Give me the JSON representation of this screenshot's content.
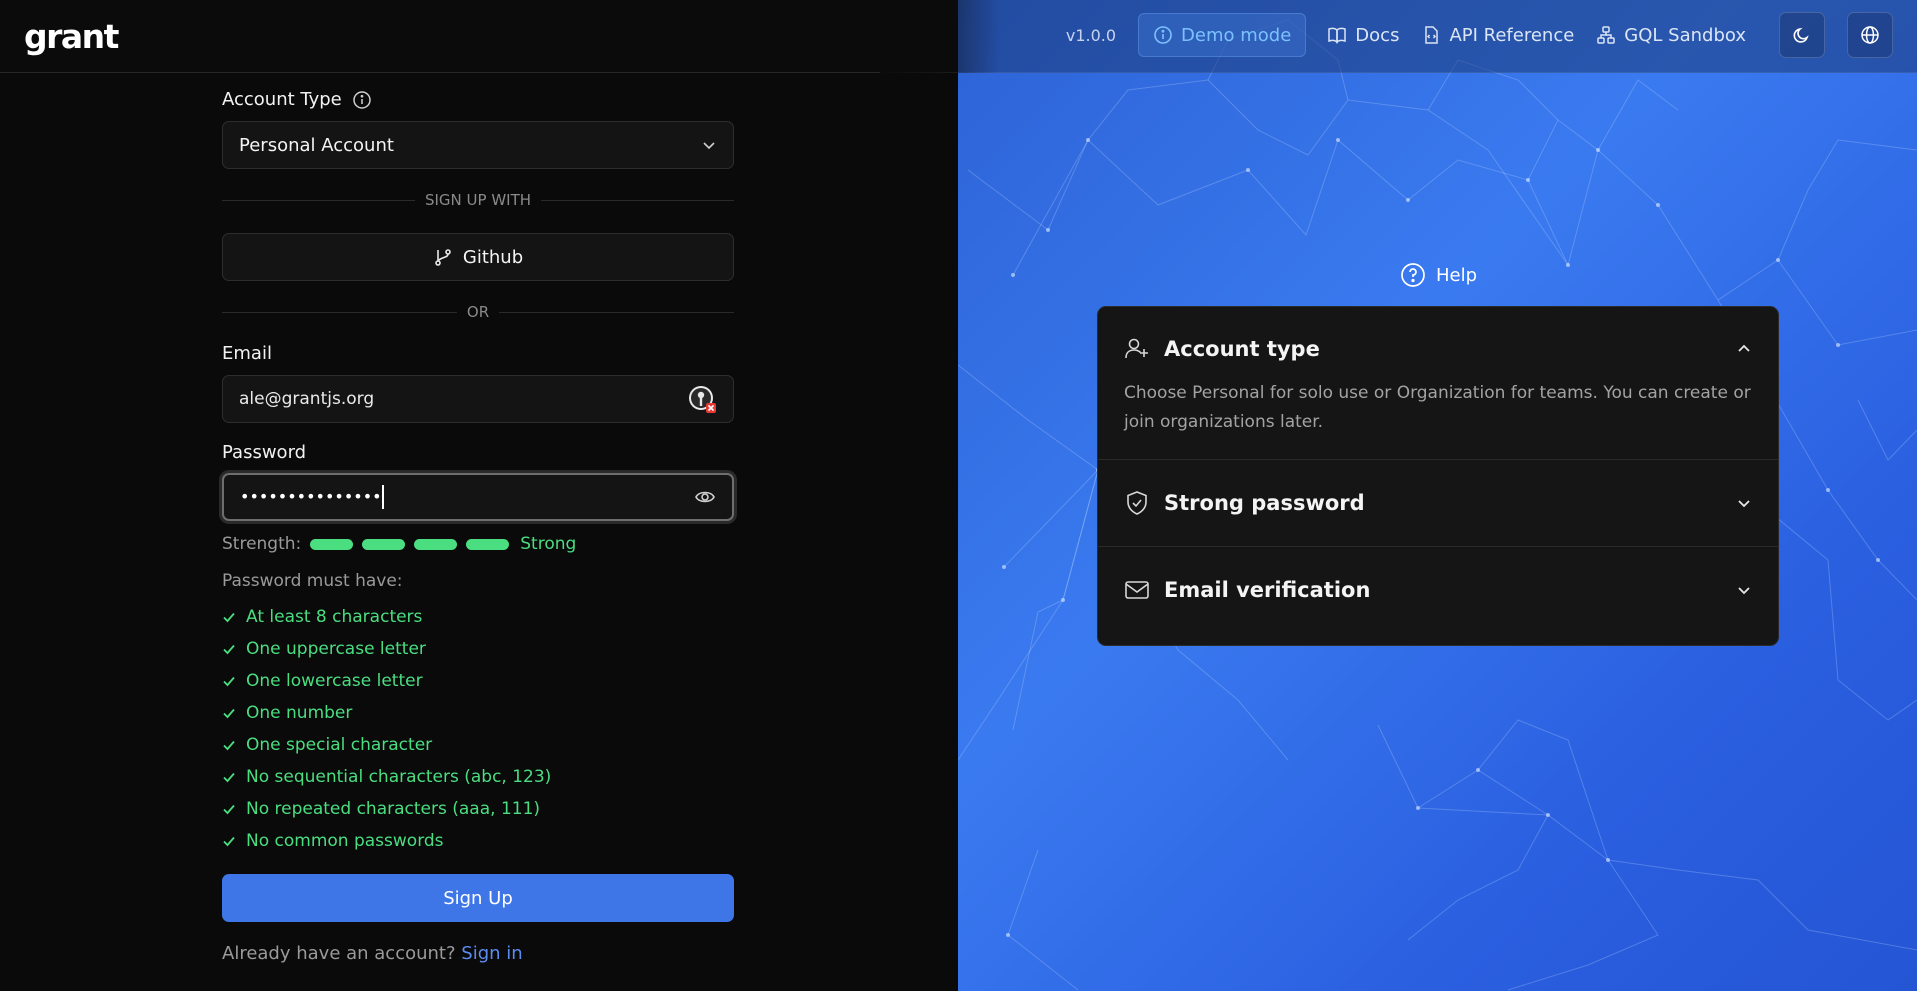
{
  "header": {
    "logo": "grant",
    "version": "v1.0.0",
    "demo_mode": "Demo mode",
    "docs": "Docs",
    "api_reference": "API Reference",
    "gql_sandbox": "GQL Sandbox"
  },
  "form": {
    "account_type_label": "Account Type",
    "account_type_value": "Personal Account",
    "sign_up_with": "SIGN UP WITH",
    "github": "Github",
    "or": "OR",
    "email_label": "Email",
    "email_value": "ale@grantjs.org",
    "password_label": "Password",
    "password_masked": "•••••••••••••••",
    "strength_label": "Strength:",
    "strength_value": "Strong",
    "strength_level": 1.0,
    "must_have": "Password must have:",
    "requirements": [
      "At least 8 characters",
      "One uppercase letter",
      "One lowercase letter",
      "One number",
      "One special character",
      "No sequential characters (abc, 123)",
      "No repeated characters (aaa, 111)",
      "No common passwords"
    ],
    "sign_up": "Sign Up",
    "have_account": "Already have an account?",
    "sign_in": "Sign in"
  },
  "help": {
    "title": "Help",
    "items": [
      {
        "title": "Account type",
        "icon": "user-plus-icon",
        "expanded": true,
        "body": "Choose Personal for solo use or Organization for teams. You can create or join organizations later."
      },
      {
        "title": "Strong password",
        "icon": "shield-check-icon",
        "expanded": false
      },
      {
        "title": "Email verification",
        "icon": "mail-icon",
        "expanded": false
      }
    ]
  },
  "colors": {
    "accent": "#3e76e8",
    "success": "#4ade80",
    "panel_bg": "#0a0a0a",
    "card_bg": "#151515"
  }
}
